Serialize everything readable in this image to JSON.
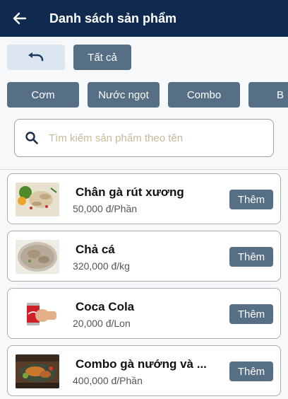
{
  "header": {
    "title": "Danh sách sản phẩm",
    "back_icon": "arrow-left-icon"
  },
  "actions": {
    "undo_icon": "undo-icon",
    "all_label": "Tất cả"
  },
  "categories": [
    {
      "label": "Cơm"
    },
    {
      "label": "Nước ngọt"
    },
    {
      "label": "Combo"
    },
    {
      "label": "B"
    }
  ],
  "search": {
    "placeholder": "Tìm kiếm sản phẩm theo tên",
    "icon": "search-icon"
  },
  "products": [
    {
      "name": "Chân gà rút xương",
      "price": "50,000 đ/Phần",
      "button": "Thêm"
    },
    {
      "name": "Chả cá",
      "price": "320,000 đ/kg",
      "button": "Thêm"
    },
    {
      "name": "Coca Cola",
      "price": "20,000 đ/Lon",
      "button": "Thêm"
    },
    {
      "name": "Combo gà nướng và ...",
      "price": "400,000 đ/Phần",
      "button": "Thêm"
    }
  ],
  "colors": {
    "header_bg": "#0f2a4e",
    "button_bg": "#566f84",
    "undo_bg": "#dbe6f0"
  }
}
